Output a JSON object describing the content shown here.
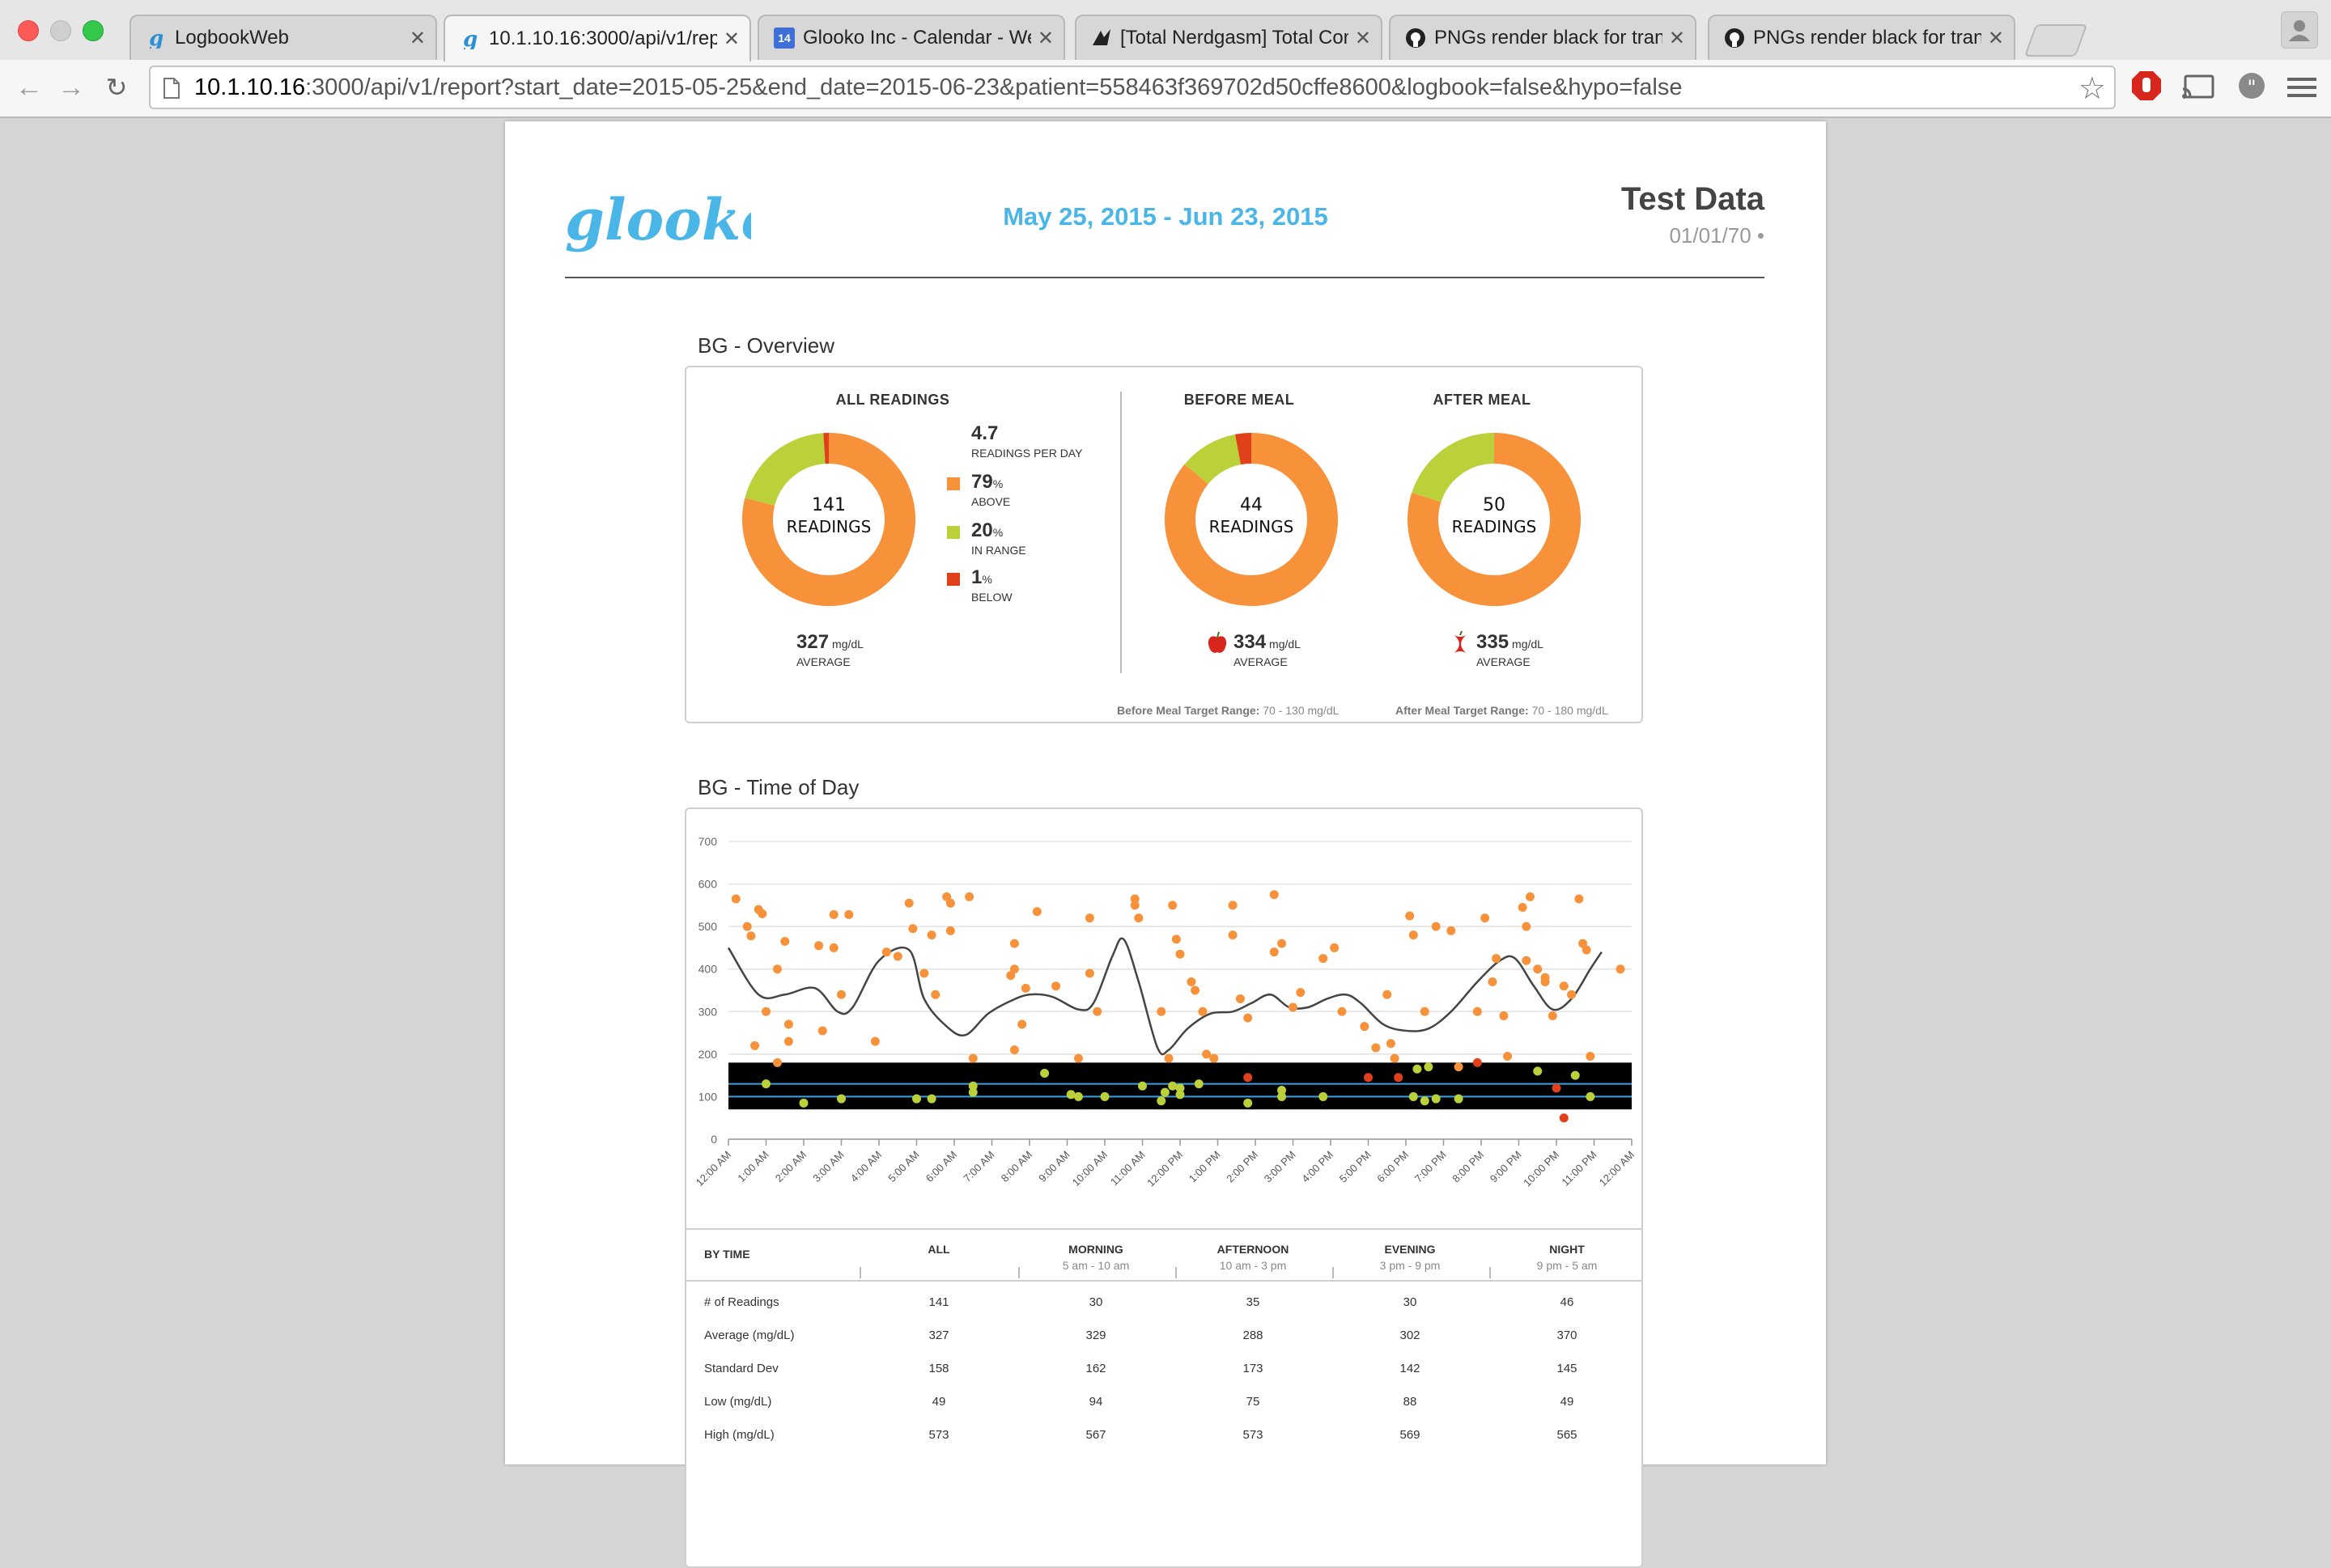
{
  "browser": {
    "tabs": [
      {
        "title": "LogbookWeb",
        "icon": "glooko-icon"
      },
      {
        "title": "10.1.10.16:3000/api/v1/rep",
        "icon": "glooko-icon"
      },
      {
        "title": "Glooko Inc - Calendar - We",
        "icon": "calendar-icon",
        "icon_text": "14"
      },
      {
        "title": "[Total Nerdgasm] Total Con",
        "icon": "nerdgasm-icon"
      },
      {
        "title": "PNGs render black for tran",
        "icon": "github-icon"
      },
      {
        "title": "PNGs render black for tran",
        "icon": "github-icon"
      }
    ],
    "close_glyph": "✕",
    "url_host": "10.1.10.16",
    "url_rest": ":3000/api/v1/report?start_date=2015-05-25&end_date=2015-06-23&patient=558463f369702d50cffe8600&logbook=false&hypo=false"
  },
  "report": {
    "logo_text": "glooko",
    "date_range": "May 25, 2015 - Jun 23, 2015",
    "patient_name": "Test Data",
    "patient_dob": "01/01/70 •"
  },
  "overview": {
    "section_title": "BG - Overview",
    "all": {
      "title": "ALL READINGS",
      "count": "141",
      "count_label": "READINGS",
      "average": "327",
      "unit": "mg/dL",
      "average_label": "AVERAGE",
      "readings_per_day": "4.7",
      "readings_per_day_label": "READINGS PER DAY",
      "legend": [
        {
          "value": "79",
          "pct": "%",
          "label": "ABOVE",
          "color": "#f7923a"
        },
        {
          "value": "20",
          "pct": "%",
          "label": "IN RANGE",
          "color": "#bcd03a"
        },
        {
          "value": "1",
          "pct": "%",
          "label": "BELOW",
          "color": "#e0401a"
        }
      ],
      "slices": {
        "above": 79,
        "in_range": 20,
        "below": 1
      }
    },
    "before_meal": {
      "title": "BEFORE MEAL",
      "count": "44",
      "count_label": "READINGS",
      "average": "334",
      "unit": "mg/dL",
      "average_label": "AVERAGE",
      "slices": {
        "above": 86,
        "in_range": 11,
        "below": 3
      },
      "target_label": "Before Meal Target Range:",
      "target_value": "70 - 130 mg/dL"
    },
    "after_meal": {
      "title": "AFTER MEAL",
      "count": "50",
      "count_label": "READINGS",
      "average": "335",
      "unit": "mg/dL",
      "average_label": "AVERAGE",
      "slices": {
        "above": 80,
        "in_range": 20,
        "below": 0
      },
      "target_label": "After Meal Target Range:",
      "target_value": "70 - 180 mg/dL"
    },
    "colors": {
      "above": "#f7923a",
      "in_range": "#bcd03a",
      "below": "#e0401a",
      "apple": "#d9261c"
    }
  },
  "time_of_day": {
    "section_title": "BG - Time of Day",
    "chart_data": {
      "type": "scatter",
      "title": "",
      "xlabel": "",
      "ylabel": "",
      "ylim": [
        0,
        700
      ],
      "yticks": [
        "0",
        "100",
        "200",
        "300",
        "400",
        "500",
        "600",
        "700"
      ],
      "xticks": [
        "12:00 AM",
        "1:00 AM",
        "2:00 AM",
        "3:00 AM",
        "4:00 AM",
        "5:00 AM",
        "6:00 AM",
        "7:00 AM",
        "8:00 AM",
        "9:00 AM",
        "10:00 AM",
        "11:00 AM",
        "12:00 PM",
        "1:00 PM",
        "2:00 PM",
        "3:00 PM",
        "4:00 PM",
        "5:00 PM",
        "6:00 PM",
        "7:00 PM",
        "8:00 PM",
        "9:00 PM",
        "10:00 PM",
        "11:00 PM",
        "12:00 AM"
      ],
      "target_band": [
        70,
        180
      ],
      "target_lines": [
        100,
        130
      ],
      "grid": true,
      "series": [
        {
          "color": "#f7923a",
          "points": [
            [
              0.2,
              565
            ],
            [
              0.5,
              500
            ],
            [
              0.6,
              478
            ],
            [
              0.8,
              540
            ],
            [
              0.9,
              530
            ],
            [
              1.0,
              300
            ],
            [
              0.7,
              220
            ],
            [
              1.3,
              180
            ],
            [
              1.3,
              400
            ],
            [
              1.5,
              465
            ],
            [
              1.6,
              270
            ],
            [
              1.6,
              230
            ],
            [
              2.4,
              455
            ],
            [
              2.5,
              255
            ],
            [
              2.8,
              528
            ],
            [
              3.2,
              528
            ],
            [
              2.8,
              450
            ],
            [
              3.0,
              340
            ],
            [
              3.9,
              230
            ],
            [
              4.2,
              440
            ],
            [
              4.5,
              430
            ],
            [
              4.8,
              555
            ],
            [
              4.9,
              495
            ],
            [
              5.2,
              390
            ],
            [
              5.4,
              480
            ],
            [
              5.5,
              340
            ],
            [
              5.8,
              570
            ],
            [
              5.9,
              555
            ],
            [
              5.9,
              490
            ],
            [
              6.4,
              570
            ],
            [
              6.5,
              190
            ],
            [
              7.5,
              385
            ],
            [
              7.6,
              400
            ],
            [
              7.6,
              460
            ],
            [
              7.9,
              355
            ],
            [
              7.8,
              270
            ],
            [
              7.6,
              210
            ],
            [
              8.2,
              535
            ],
            [
              8.7,
              360
            ],
            [
              9.3,
              190
            ],
            [
              9.6,
              390
            ],
            [
              9.6,
              520
            ],
            [
              9.8,
              300
            ],
            [
              10.8,
              565
            ],
            [
              10.8,
              550
            ],
            [
              10.9,
              520
            ],
            [
              11.5,
              300
            ],
            [
              11.7,
              190
            ],
            [
              11.8,
              550
            ],
            [
              11.9,
              470
            ],
            [
              12.0,
              435
            ],
            [
              12.3,
              370
            ],
            [
              12.4,
              350
            ],
            [
              12.6,
              300
            ],
            [
              12.7,
              200
            ],
            [
              12.9,
              190
            ],
            [
              13.4,
              550
            ],
            [
              13.4,
              480
            ],
            [
              13.6,
              330
            ],
            [
              13.8,
              285
            ],
            [
              14.5,
              575
            ],
            [
              14.5,
              440
            ],
            [
              14.7,
              460
            ],
            [
              15.0,
              310
            ],
            [
              15.2,
              345
            ],
            [
              15.8,
              425
            ],
            [
              16.1,
              450
            ],
            [
              16.3,
              300
            ],
            [
              16.9,
              265
            ],
            [
              17.2,
              215
            ],
            [
              17.5,
              340
            ],
            [
              17.6,
              225
            ],
            [
              17.7,
              190
            ],
            [
              18.1,
              525
            ],
            [
              18.2,
              480
            ],
            [
              18.5,
              300
            ],
            [
              18.8,
              500
            ],
            [
              19.2,
              490
            ],
            [
              19.4,
              170
            ],
            [
              19.9,
              300
            ],
            [
              20.1,
              520
            ],
            [
              20.4,
              425
            ],
            [
              20.3,
              370
            ],
            [
              20.6,
              290
            ],
            [
              20.7,
              195
            ],
            [
              21.1,
              545
            ],
            [
              21.2,
              500
            ],
            [
              21.2,
              420
            ],
            [
              21.5,
              400
            ],
            [
              21.7,
              380
            ],
            [
              21.7,
              370
            ],
            [
              21.9,
              290
            ],
            [
              22.2,
              360
            ],
            [
              22.4,
              340
            ],
            [
              22.6,
              565
            ],
            [
              22.7,
              460
            ],
            [
              22.8,
              445
            ],
            [
              22.9,
              195
            ],
            [
              23.7,
              400
            ],
            [
              21.3,
              570
            ]
          ]
        },
        {
          "color": "#bcd03a",
          "points": [
            [
              1.0,
              130
            ],
            [
              2.0,
              85
            ],
            [
              3.0,
              95
            ],
            [
              5.0,
              95
            ],
            [
              5.4,
              95
            ],
            [
              6.5,
              125
            ],
            [
              6.5,
              110
            ],
            [
              8.4,
              155
            ],
            [
              9.1,
              105
            ],
            [
              9.3,
              100
            ],
            [
              10.0,
              100
            ],
            [
              11.0,
              125
            ],
            [
              11.5,
              90
            ],
            [
              11.6,
              110
            ],
            [
              11.8,
              125
            ],
            [
              12.0,
              120
            ],
            [
              12.0,
              105
            ],
            [
              12.5,
              130
            ],
            [
              13.8,
              85
            ],
            [
              14.7,
              100
            ],
            [
              14.7,
              115
            ],
            [
              15.8,
              100
            ],
            [
              18.3,
              165
            ],
            [
              18.6,
              170
            ],
            [
              18.5,
              90
            ],
            [
              18.8,
              95
            ],
            [
              19.4,
              95
            ],
            [
              21.5,
              160
            ],
            [
              22.5,
              150
            ],
            [
              22.9,
              100
            ],
            [
              18.2,
              100
            ]
          ]
        },
        {
          "color": "#e0401a",
          "points": [
            [
              22.2,
              50
            ],
            [
              22.0,
              120
            ],
            [
              17.0,
              145
            ],
            [
              17.8,
              145
            ],
            [
              13.8,
              145
            ],
            [
              19.9,
              180
            ]
          ]
        }
      ],
      "trend_line": [
        [
          0.0,
          450
        ],
        [
          0.8,
          340
        ],
        [
          1.5,
          340
        ],
        [
          2.3,
          355
        ],
        [
          2.9,
          300
        ],
        [
          3.3,
          310
        ],
        [
          4.0,
          420
        ],
        [
          4.8,
          445
        ],
        [
          5.2,
          330
        ],
        [
          5.8,
          265
        ],
        [
          6.3,
          245
        ],
        [
          6.9,
          295
        ],
        [
          7.5,
          325
        ],
        [
          8.0,
          340
        ],
        [
          8.6,
          335
        ],
        [
          9.3,
          305
        ],
        [
          9.7,
          320
        ],
        [
          10.2,
          430
        ],
        [
          10.5,
          470
        ],
        [
          10.9,
          370
        ],
        [
          11.4,
          215
        ],
        [
          11.7,
          210
        ],
        [
          12.2,
          260
        ],
        [
          12.8,
          295
        ],
        [
          13.4,
          300
        ],
        [
          13.9,
          320
        ],
        [
          14.4,
          340
        ],
        [
          14.9,
          310
        ],
        [
          15.4,
          310
        ],
        [
          15.9,
          330
        ],
        [
          16.4,
          340
        ],
        [
          16.8,
          320
        ],
        [
          17.4,
          270
        ],
        [
          18.0,
          255
        ],
        [
          18.6,
          260
        ],
        [
          19.2,
          300
        ],
        [
          19.9,
          370
        ],
        [
          20.5,
          420
        ],
        [
          20.9,
          425
        ],
        [
          21.4,
          360
        ],
        [
          21.9,
          305
        ],
        [
          22.4,
          330
        ],
        [
          22.9,
          400
        ],
        [
          23.2,
          440
        ]
      ]
    },
    "table": {
      "header": {
        "label": "BY TIME",
        "cols": [
          {
            "main": "ALL",
            "sub": ""
          },
          {
            "main": "MORNING",
            "sub": "5 am - 10 am"
          },
          {
            "main": "AFTERNOON",
            "sub": "10 am - 3 pm"
          },
          {
            "main": "EVENING",
            "sub": "3 pm - 9 pm"
          },
          {
            "main": "NIGHT",
            "sub": "9 pm - 5 am"
          }
        ]
      },
      "rows": [
        {
          "label": "# of Readings",
          "values": [
            "141",
            "30",
            "35",
            "30",
            "46"
          ]
        },
        {
          "label": "Average (mg/dL)",
          "values": [
            "327",
            "329",
            "288",
            "302",
            "370"
          ]
        },
        {
          "label": "Standard Dev",
          "values": [
            "158",
            "162",
            "173",
            "142",
            "145"
          ]
        },
        {
          "label": "Low (mg/dL)",
          "values": [
            "49",
            "94",
            "75",
            "88",
            "49"
          ]
        },
        {
          "label": "High (mg/dL)",
          "values": [
            "573",
            "567",
            "573",
            "569",
            "565"
          ]
        }
      ]
    }
  }
}
